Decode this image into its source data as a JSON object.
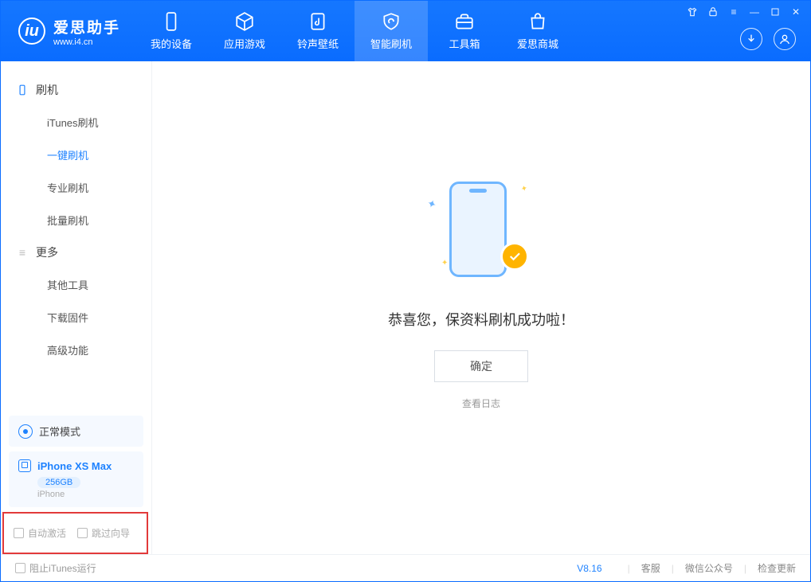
{
  "app": {
    "name": "爱思助手",
    "url": "www.i4.cn"
  },
  "tabs": [
    {
      "label": "我的设备"
    },
    {
      "label": "应用游戏"
    },
    {
      "label": "铃声壁纸"
    },
    {
      "label": "智能刷机",
      "active": true
    },
    {
      "label": "工具箱"
    },
    {
      "label": "爱思商城"
    }
  ],
  "sidebar": {
    "section1_label": "刷机",
    "section1_items": [
      {
        "label": "iTunes刷机"
      },
      {
        "label": "一键刷机",
        "active": true
      },
      {
        "label": "专业刷机"
      },
      {
        "label": "批量刷机"
      }
    ],
    "section2_label": "更多",
    "section2_items": [
      {
        "label": "其他工具"
      },
      {
        "label": "下载固件"
      },
      {
        "label": "高级功能"
      }
    ]
  },
  "mode": {
    "label": "正常模式"
  },
  "device": {
    "name": "iPhone XS Max",
    "capacity": "256GB",
    "sub": "iPhone"
  },
  "options": {
    "auto_activate": "自动激活",
    "skip_guide": "跳过向导"
  },
  "main": {
    "success_text": "恭喜您，保资料刷机成功啦！",
    "ok_label": "确定",
    "log_link": "查看日志"
  },
  "footer": {
    "block_itunes": "阻止iTunes运行",
    "version": "V8.16",
    "links": {
      "kefu": "客服",
      "wechat": "微信公众号",
      "update": "检查更新"
    }
  }
}
